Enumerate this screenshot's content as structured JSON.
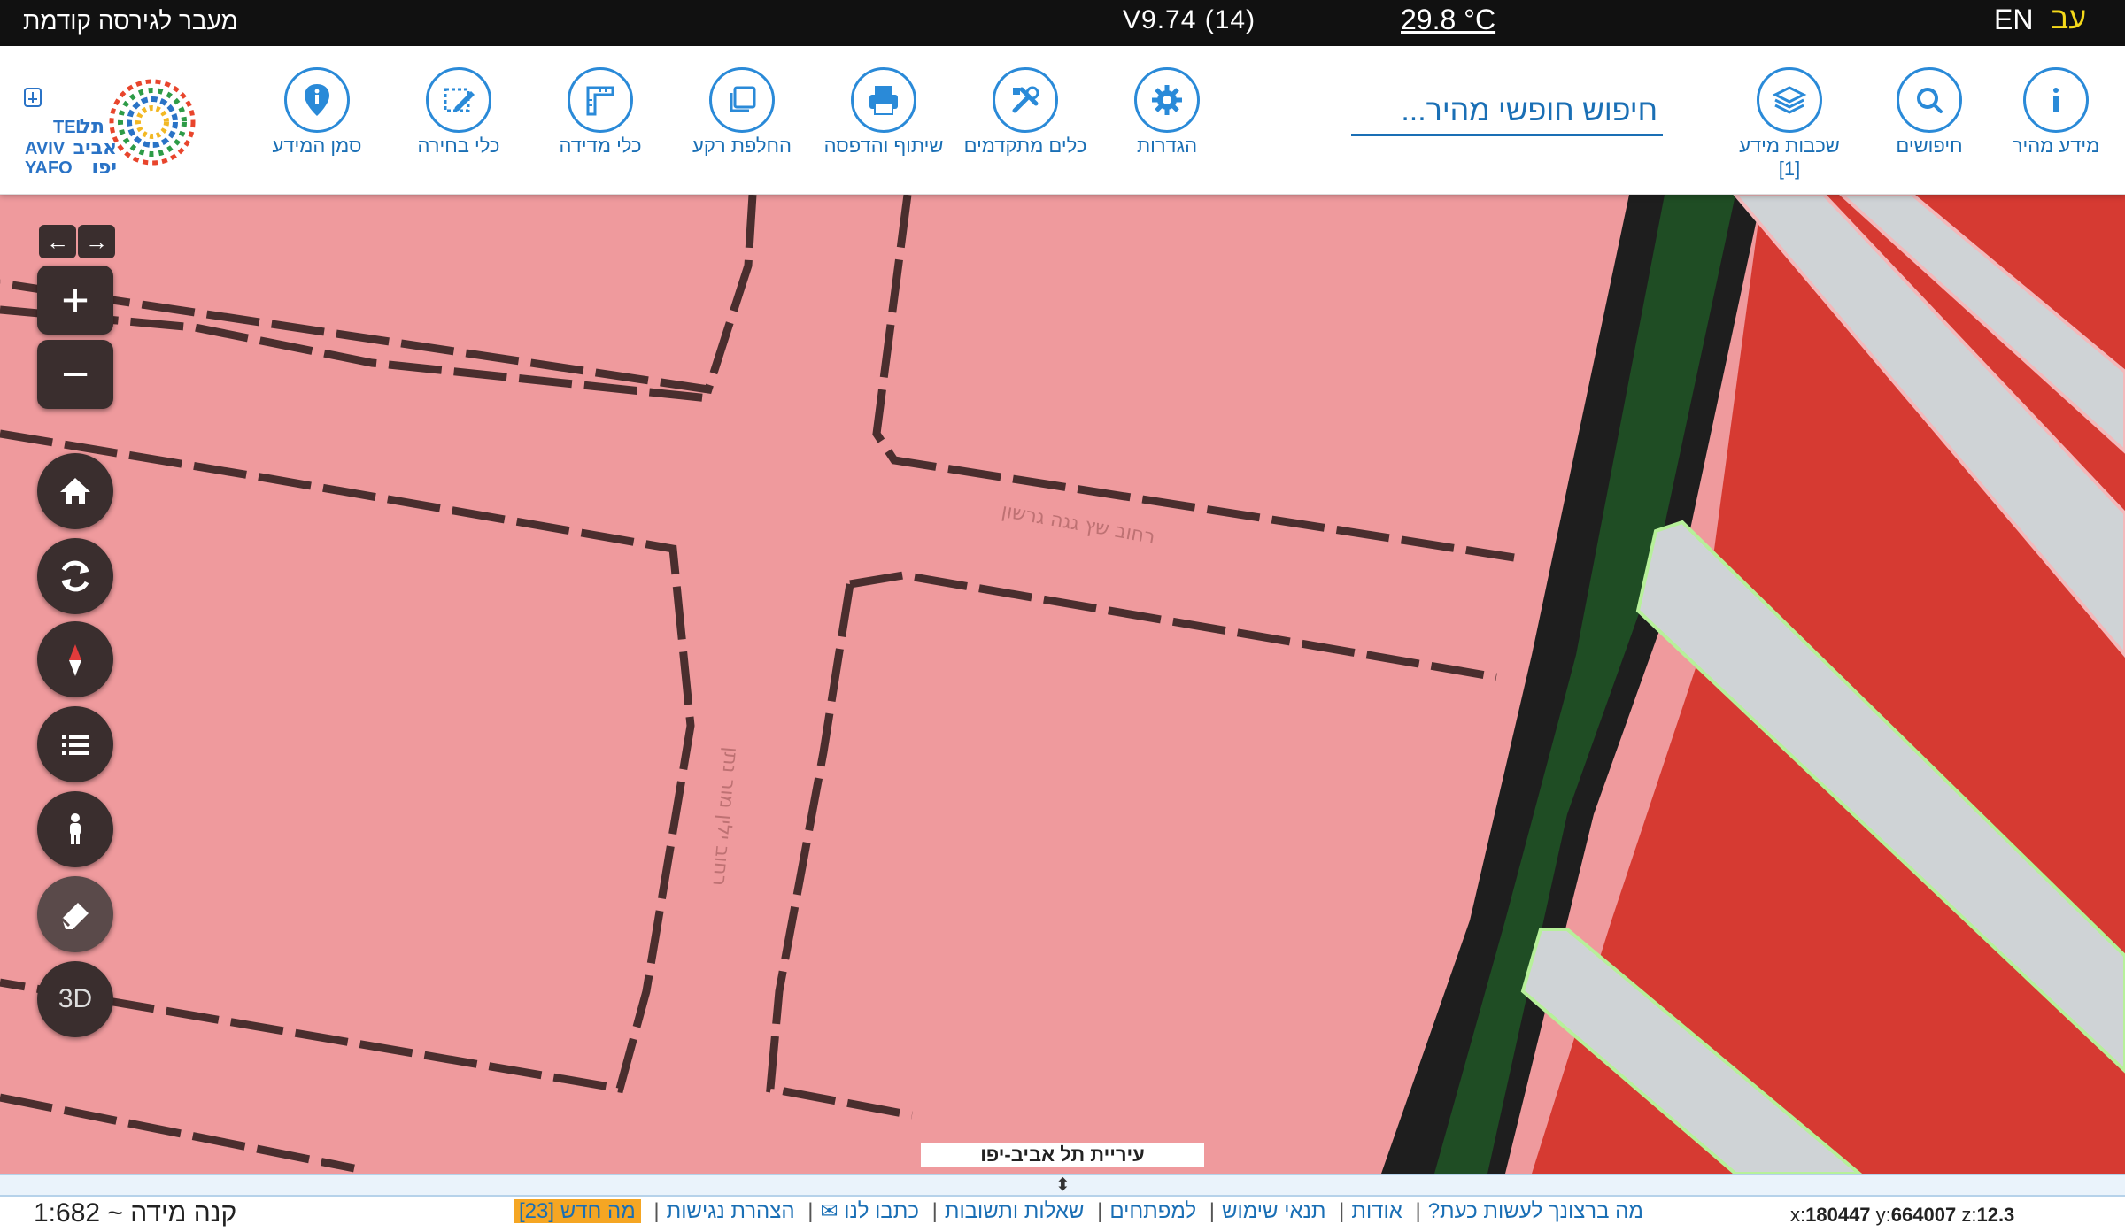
{
  "topbar": {
    "previous_version": "מעבר לגירסה קודמת",
    "version": "V9.74 (14)",
    "temperature": "29.8 °C",
    "lang_en": "EN",
    "lang_he": "עב"
  },
  "logo": {
    "line1_he": "תל",
    "line2_he": "אביב",
    "line3_he": "יפו",
    "line1_en": "TEL",
    "line2_en": "AVIV",
    "line3_en": "YAFO"
  },
  "toolbar": {
    "tools": [
      {
        "id": "quick-info",
        "label": "מידע מהיר",
        "icon": "info-icon"
      },
      {
        "id": "searches",
        "label": "חיפושים",
        "icon": "search-icon"
      },
      {
        "id": "info-layers",
        "label": "שכבות מידע",
        "sublabel": "[1]",
        "icon": "layers-icon"
      },
      {
        "id": "settings",
        "label": "הגדרות",
        "icon": "gear-icon"
      },
      {
        "id": "advanced-tools",
        "label": "כלים מתקדמים",
        "icon": "tools-icon"
      },
      {
        "id": "share-print",
        "label": "שיתוף והדפסה",
        "icon": "printer-icon"
      },
      {
        "id": "change-background",
        "label": "החלפת רקע",
        "icon": "copy-icon"
      },
      {
        "id": "measure-tools",
        "label": "כלי מדידה",
        "icon": "ruler-icon"
      },
      {
        "id": "selection-tools",
        "label": "כלי בחירה",
        "icon": "select-edit-icon"
      },
      {
        "id": "info-marker",
        "label": "סמן המידע",
        "icon": "map-pin-info-icon"
      }
    ],
    "search_placeholder": "חיפוש חופשי מהיר..."
  },
  "map": {
    "street_labels": [
      "רחוב שץ גגה גרשון",
      "רחוב ילין מור נתן"
    ],
    "attribution": "עיריית תל אביב-יפו",
    "controls": {
      "back": "←",
      "forward": "→",
      "zoom_in": "+",
      "zoom_out": "−",
      "three_d": "3D"
    },
    "colors": {
      "pink_area": "#ef9a9d",
      "red_area": "#d63a32",
      "green_strip": "#1f4d24",
      "road_gray": "#cfd3d6",
      "dark_border": "#4a2e2e"
    }
  },
  "footer": {
    "scale": "קנה מידה ~ 1:682",
    "links": [
      "מה ברצונך לעשות כעת?",
      "אודות",
      "תנאי שימוש",
      "למפתחים",
      "שאלות ותשובות",
      "כתבו לנו ✉",
      "הצהרת נגישות"
    ],
    "whats_new": "מה חדש [23]",
    "coords": {
      "x_label": "x:",
      "x": "180447",
      "y_label": "y:",
      "y": "664007",
      "z_label": "z:",
      "z": "12.3"
    }
  }
}
